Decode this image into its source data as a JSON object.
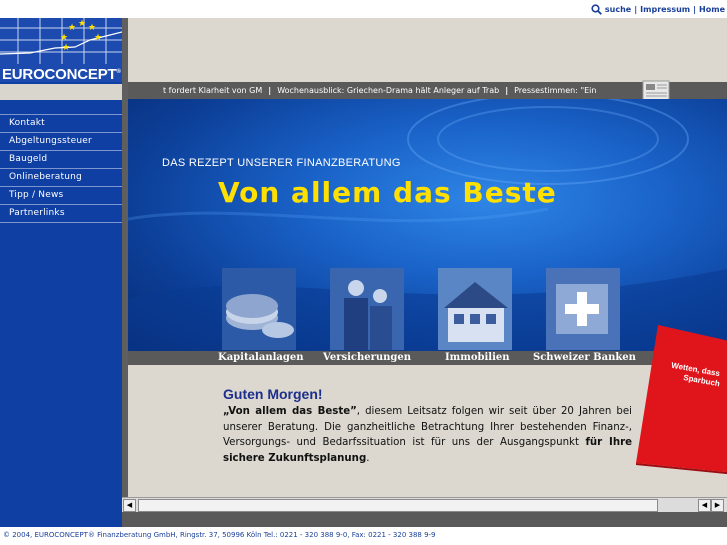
{
  "top_links": {
    "search": "suche",
    "impressum": "Impressum",
    "home": "Home"
  },
  "logo": {
    "name": "EUROCONCEPT",
    "reg": "®"
  },
  "nav": {
    "items": [
      {
        "label": "Kontakt"
      },
      {
        "label": "Abgeltungssteuer"
      },
      {
        "label": "Baugeld"
      },
      {
        "label": "Onlineberatung"
      },
      {
        "label": "Tipp / News"
      },
      {
        "label": "Partnerlinks"
      }
    ]
  },
  "ticker": {
    "items": [
      "t fordert Klarheit von GM",
      "Wochenausblick: Griechen-Drama hält Anleger auf Trab",
      "Pressestimmen: \"Ein"
    ]
  },
  "hero": {
    "subtitle": "DAS REZEPT UNSERER FINANZBERATUNG",
    "title": "Von allem das Beste"
  },
  "categories": [
    {
      "label": "Kapitalanlagen"
    },
    {
      "label": "Versicherungen"
    },
    {
      "label": "Immobilien"
    },
    {
      "label": "Schweizer Banken"
    }
  ],
  "content": {
    "greeting": "Guten Morgen!",
    "quote": "„Von allem das Beste”",
    "text1": ", diesem Leitsatz folgen wir seit über 20 Jahren bei unserer Beratung. Die ganzheitliche Betrachtung Ihrer bestehenden Finanz-, Versorgungs- und Bedarfssituation ist für uns der Ausgangspunkt ",
    "bold_end": "für Ihre sichere Zukunftsplanung",
    "text2": "."
  },
  "promo": {
    "line1": "Wetten, dass",
    "line2": "Sparbuch"
  },
  "footer": {
    "text": "© 2004, EUROCONCEPT® Finanzberatung GmbH, Ringstr. 37, 50996 Köln Tel.: 0221 - 320 388 9-0, Fax: 0221 - 320 388 9-9"
  },
  "colors": {
    "nav_blue": "#0f3fa3",
    "title_yellow": "#ffe000",
    "promo_red": "#e0151c",
    "beige": "#dcd8cf"
  }
}
